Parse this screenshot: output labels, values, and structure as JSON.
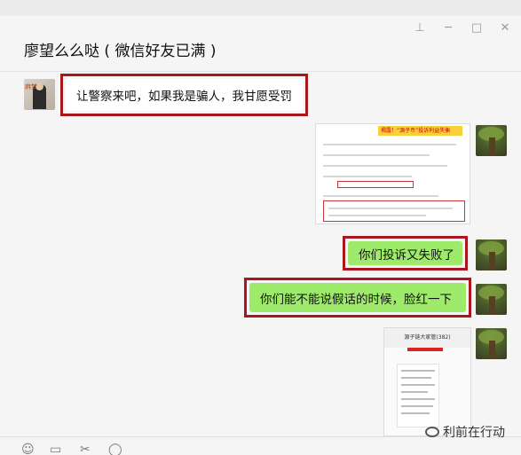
{
  "window": {
    "title": "廖望么么哒 ( 微信好友已满 )",
    "controls": {
      "pin": "⊥",
      "minimize": "─",
      "maximize": "□",
      "close": "✕"
    }
  },
  "messages": [
    {
      "side": "left",
      "type": "text",
      "text": "让警察来吧，如果我是骗人，我甘愿受罚"
    },
    {
      "side": "right",
      "type": "image",
      "banner": "揭露！“源子币”投诉利益失衡"
    },
    {
      "side": "right",
      "type": "text",
      "text": "你们投诉又失败了"
    },
    {
      "side": "right",
      "type": "text",
      "text": "你们能不能说假话的时候，脸红一下"
    },
    {
      "side": "right",
      "type": "image",
      "header": "源子链大家管(382)"
    }
  ],
  "toolbar": {
    "emoji": "☺",
    "folder": "▭",
    "clip": "✂",
    "chat": "◯"
  },
  "watermark": {
    "text": "利前在行动"
  }
}
